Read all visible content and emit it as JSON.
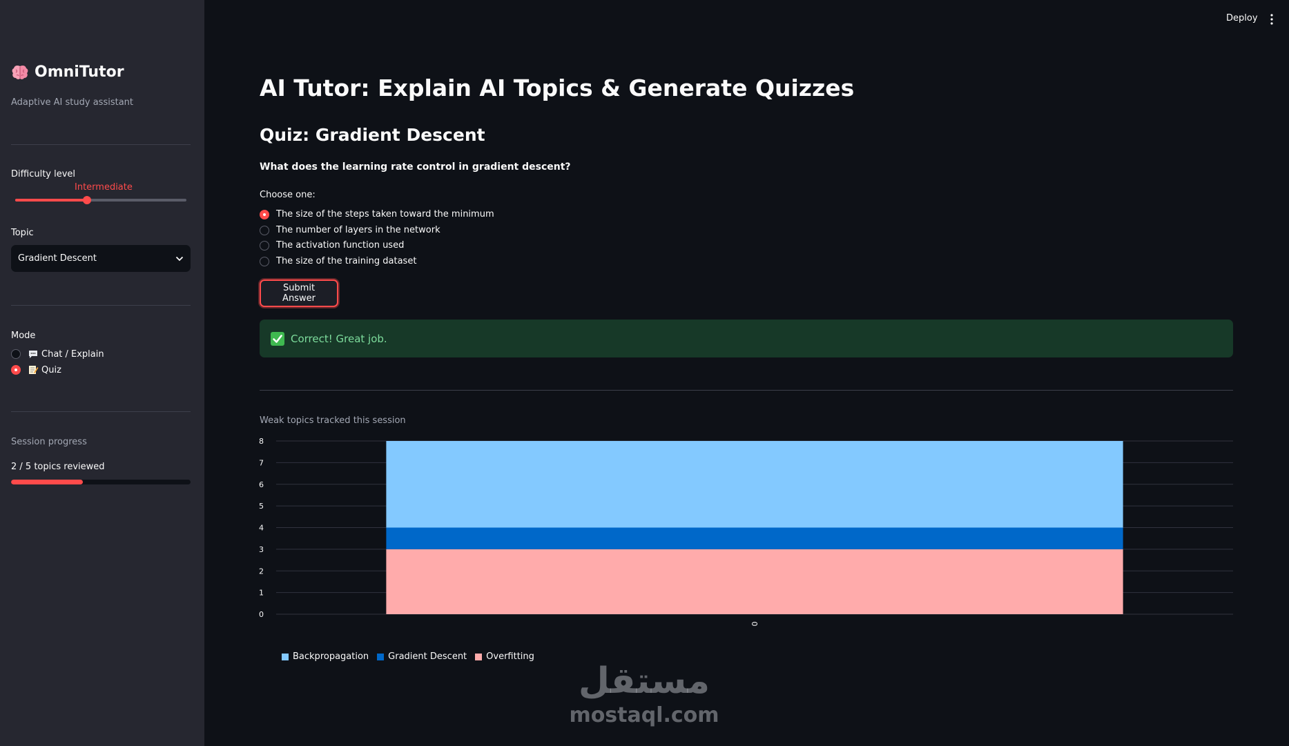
{
  "sidebar": {
    "title": "OmniTutor",
    "tagline": "Adaptive AI study assistant",
    "difficulty": {
      "label": "Difficulty level",
      "value": "Intermediate",
      "level_fraction": 0.42
    },
    "topic": {
      "label": "Topic",
      "selected": "Gradient Descent"
    },
    "mode": {
      "label": "Mode",
      "options": [
        {
          "label": "Chat / Explain",
          "icon": "speech-bubble-icon",
          "selected": false
        },
        {
          "label": "Quiz",
          "icon": "memo-icon",
          "selected": true
        }
      ]
    },
    "progress": {
      "label": "Session progress",
      "text": "2 / 5 topics reviewed",
      "value": 0.4
    }
  },
  "header": {
    "deploy_label": "Deploy"
  },
  "main": {
    "title": "AI Tutor: Explain AI Topics & Generate Quizzes",
    "quiz_title": "Quiz: Gradient Descent",
    "question": "What does the learning rate control in gradient descent?",
    "choose_label": "Choose one:",
    "options": [
      {
        "label": "The size of the steps taken toward the minimum",
        "selected": true
      },
      {
        "label": "The number of layers in the network",
        "selected": false
      },
      {
        "label": "The activation function used",
        "selected": false
      },
      {
        "label": "The size of the training dataset",
        "selected": false
      }
    ],
    "submit_label": "Submit Answer",
    "result_message": "Correct! Great job.",
    "chart_caption": "Weak topics tracked this session"
  },
  "watermark": {
    "arabic": "مستقل",
    "latin": "mostaql.com"
  },
  "colors": {
    "accent": "#ff4b4b",
    "success_bg": "#173928",
    "success_text": "#7ddc9c"
  },
  "chart_data": {
    "type": "bar",
    "stacked": true,
    "categories": [
      "0"
    ],
    "series": [
      {
        "name": "Overfitting",
        "values": [
          3
        ],
        "color": "#ffabab"
      },
      {
        "name": "Gradient Descent",
        "values": [
          1
        ],
        "color": "#0068c9"
      },
      {
        "name": "Backpropagation",
        "values": [
          4
        ],
        "color": "#83c9ff"
      }
    ],
    "legend_order": [
      "Backpropagation",
      "Gradient Descent",
      "Overfitting"
    ],
    "yticks": [
      "0",
      "1",
      "2",
      "3",
      "4",
      "5",
      "6",
      "7",
      "8"
    ],
    "ylim": [
      0,
      8
    ],
    "grid": true,
    "legend_position": "bottom-left"
  }
}
